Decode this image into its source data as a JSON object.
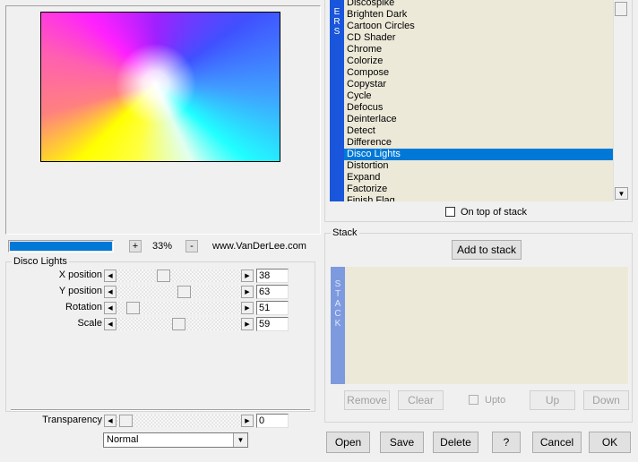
{
  "zoom": {
    "plus_label": "+",
    "value": "33%",
    "minus_label": "-"
  },
  "progress": {
    "fraction": 1.0,
    "color": "#0078d7"
  },
  "website": "www.VanDerLee.com",
  "filters": {
    "side_label": "ERS",
    "items": [
      "Brighten Dark",
      "Cartoon Circles",
      "CD Shader",
      "Chrome",
      "Colorize",
      "Compose",
      "Copystar",
      "Cycle",
      "Defocus",
      "Deinterlace",
      "Detect",
      "Difference",
      "Disco Lights",
      "Distortion",
      "Expand",
      "Factorize",
      "Finish Flag"
    ],
    "partial_top": "Discospike",
    "selected": "Disco Lights",
    "on_top_label": "On top of stack"
  },
  "params": {
    "title": "Disco Lights",
    "sliders": [
      {
        "label": "X position",
        "value": "38",
        "level": 0.36
      },
      {
        "label": "Y position",
        "value": "63",
        "level": 0.55
      },
      {
        "label": "Rotation",
        "value": "51",
        "level": 0.09
      },
      {
        "label": "Scale",
        "value": "59",
        "level": 0.5
      }
    ],
    "transparency": {
      "label": "Transparency",
      "value": "0",
      "level": 0.0
    },
    "blend_mode": "Normal"
  },
  "stack": {
    "title": "Stack",
    "add_label": "Add to stack",
    "side_label": "STACK",
    "remove_label": "Remove",
    "clear_label": "Clear",
    "upto_label": "Upto",
    "up_label": "Up",
    "down_label": "Down"
  },
  "footer": {
    "open_label": "Open",
    "save_label": "Save",
    "delete_label": "Delete",
    "help_label": "?",
    "cancel_label": "Cancel",
    "ok_label": "OK"
  },
  "colors": {
    "accent": "#0078d7",
    "list_bg": "#ece9d8",
    "side_bar": "#1a56db",
    "stack_bar": "#7e9adf"
  }
}
